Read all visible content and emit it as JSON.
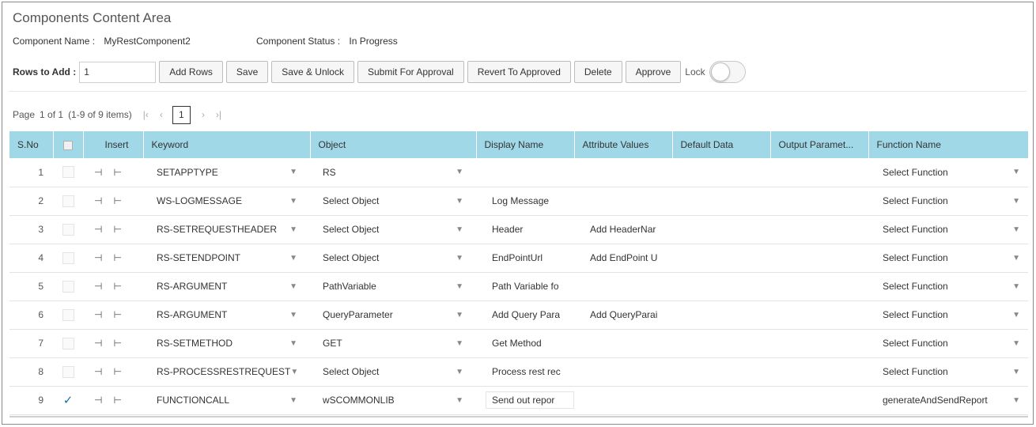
{
  "header": {
    "title": "Components Content Area",
    "component_name_label": "Component Name :",
    "component_name_value": "MyRestComponent2",
    "component_status_label": "Component Status :",
    "component_status_value": "In Progress"
  },
  "toolbar": {
    "rows_to_add_label": "Rows to Add :",
    "rows_to_add_value": "1",
    "add_rows": "Add Rows",
    "save": "Save",
    "save_unlock": "Save & Unlock",
    "submit_for_approval": "Submit For Approval",
    "revert_to_approved": "Revert To Approved",
    "delete": "Delete",
    "approve": "Approve",
    "lock_label": "Lock",
    "lock_on": false
  },
  "pager": {
    "page_label": "Page",
    "page_of": "1 of 1",
    "items": "(1-9 of 9 items)",
    "current_page": "1",
    "first_icon": "first-page-icon",
    "prev_icon": "prev-page-icon",
    "next_icon": "next-page-icon",
    "last_icon": "last-page-icon"
  },
  "table": {
    "columns": [
      "S.No",
      "",
      "Insert",
      "Keyword",
      "Object",
      "Display Name",
      "Attribute Values",
      "Default Data",
      "Output Paramet...",
      "Function Name"
    ],
    "rows": [
      {
        "sno": "1",
        "checked": false,
        "keyword": "SETAPPTYPE",
        "object": "RS",
        "display_name": "",
        "attribute_values": "",
        "default_data": "",
        "output_param": "",
        "function_name": "Select Function"
      },
      {
        "sno": "2",
        "checked": false,
        "keyword": "WS-LOGMESSAGE",
        "object": "Select Object",
        "display_name": "Log Message",
        "attribute_values": "",
        "default_data": "",
        "output_param": "",
        "function_name": "Select Function"
      },
      {
        "sno": "3",
        "checked": false,
        "keyword": "RS-SETREQUESTHEADER",
        "object": "Select Object",
        "display_name": "Header",
        "attribute_values": "Add HeaderNar",
        "default_data": "",
        "output_param": "",
        "function_name": "Select Function"
      },
      {
        "sno": "4",
        "checked": false,
        "keyword": "RS-SETENDPOINT",
        "object": "Select Object",
        "display_name": "EndPointUrl",
        "attribute_values": "Add EndPoint U",
        "default_data": "",
        "output_param": "",
        "function_name": "Select Function"
      },
      {
        "sno": "5",
        "checked": false,
        "keyword": "RS-ARGUMENT",
        "object": "PathVariable",
        "display_name": "Path Variable fo",
        "attribute_values": "",
        "default_data": "",
        "output_param": "",
        "function_name": "Select Function"
      },
      {
        "sno": "6",
        "checked": false,
        "keyword": "RS-ARGUMENT",
        "object": "QueryParameter",
        "display_name": "Add Query Para",
        "attribute_values": "Add QueryParai",
        "default_data": "",
        "output_param": "",
        "function_name": "Select Function"
      },
      {
        "sno": "7",
        "checked": false,
        "keyword": "RS-SETMETHOD",
        "object": "GET",
        "display_name": "Get Method",
        "attribute_values": "",
        "default_data": "",
        "output_param": "",
        "function_name": "Select Function"
      },
      {
        "sno": "8",
        "checked": false,
        "keyword": "RS-PROCESSRESTREQUEST",
        "object": "Select Object",
        "display_name": "Process rest rec",
        "attribute_values": "",
        "default_data": "",
        "output_param": "",
        "function_name": "Select Function"
      },
      {
        "sno": "9",
        "checked": true,
        "keyword": "FUNCTIONCALL",
        "object": "wSCOMMONLIB",
        "display_name": "Send out repor",
        "attribute_values": "",
        "default_data": "",
        "output_param": "",
        "function_name": "generateAndSendReport"
      }
    ]
  },
  "icons": {
    "insert_above": "insert-row-above-icon",
    "insert_below": "insert-row-below-icon",
    "dropdown": "caret-down-icon",
    "checked": "checkmark-icon"
  },
  "colors": {
    "header_bg": "#a1d8e7",
    "check_color": "#1b6fa8"
  }
}
